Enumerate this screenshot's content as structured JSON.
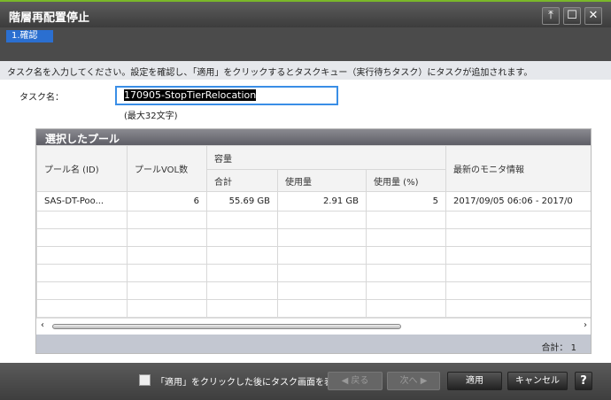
{
  "window": {
    "title": "階層再配置停止",
    "pin_icon": "pin-icon",
    "maximize_icon": "maximize-icon",
    "close_icon": "close-icon"
  },
  "steps": [
    {
      "label": "1.確認",
      "active": true
    }
  ],
  "instruction": "タスク名を入力してください。設定を確認し、「適用」をクリックするとタスクキュー（実行待ちタスク）にタスクが追加されます。",
  "task": {
    "label": "タスク名：",
    "value": "170905-StopTierRelocation",
    "hint": "(最大32文字)"
  },
  "panel": {
    "title": "選択したプール",
    "headers": {
      "pool_name": "プール名 (ID)",
      "pool_vol": "プールVOL数",
      "capacity": "容量",
      "total": "合計",
      "used": "使用量",
      "used_pct": "使用量 (%)",
      "monitor": "最新のモニタ情報"
    },
    "rows": [
      {
        "pool_name": "SAS-DT-Poo...",
        "pool_vol": "6",
        "total": "55.69 GB",
        "used": "2.91 GB",
        "used_pct": "5",
        "monitor": "2017/09/05 06:06 - 2017/0"
      }
    ],
    "total_label": "合計：",
    "total_value": "1"
  },
  "footer": {
    "checkbox_label": "「適用」をクリックした後にタスク画面を表示",
    "checked": false,
    "back": "◀ 戻る",
    "next": "次へ ▶",
    "apply": "適用",
    "cancel": "キャンセル",
    "help": "?"
  }
}
